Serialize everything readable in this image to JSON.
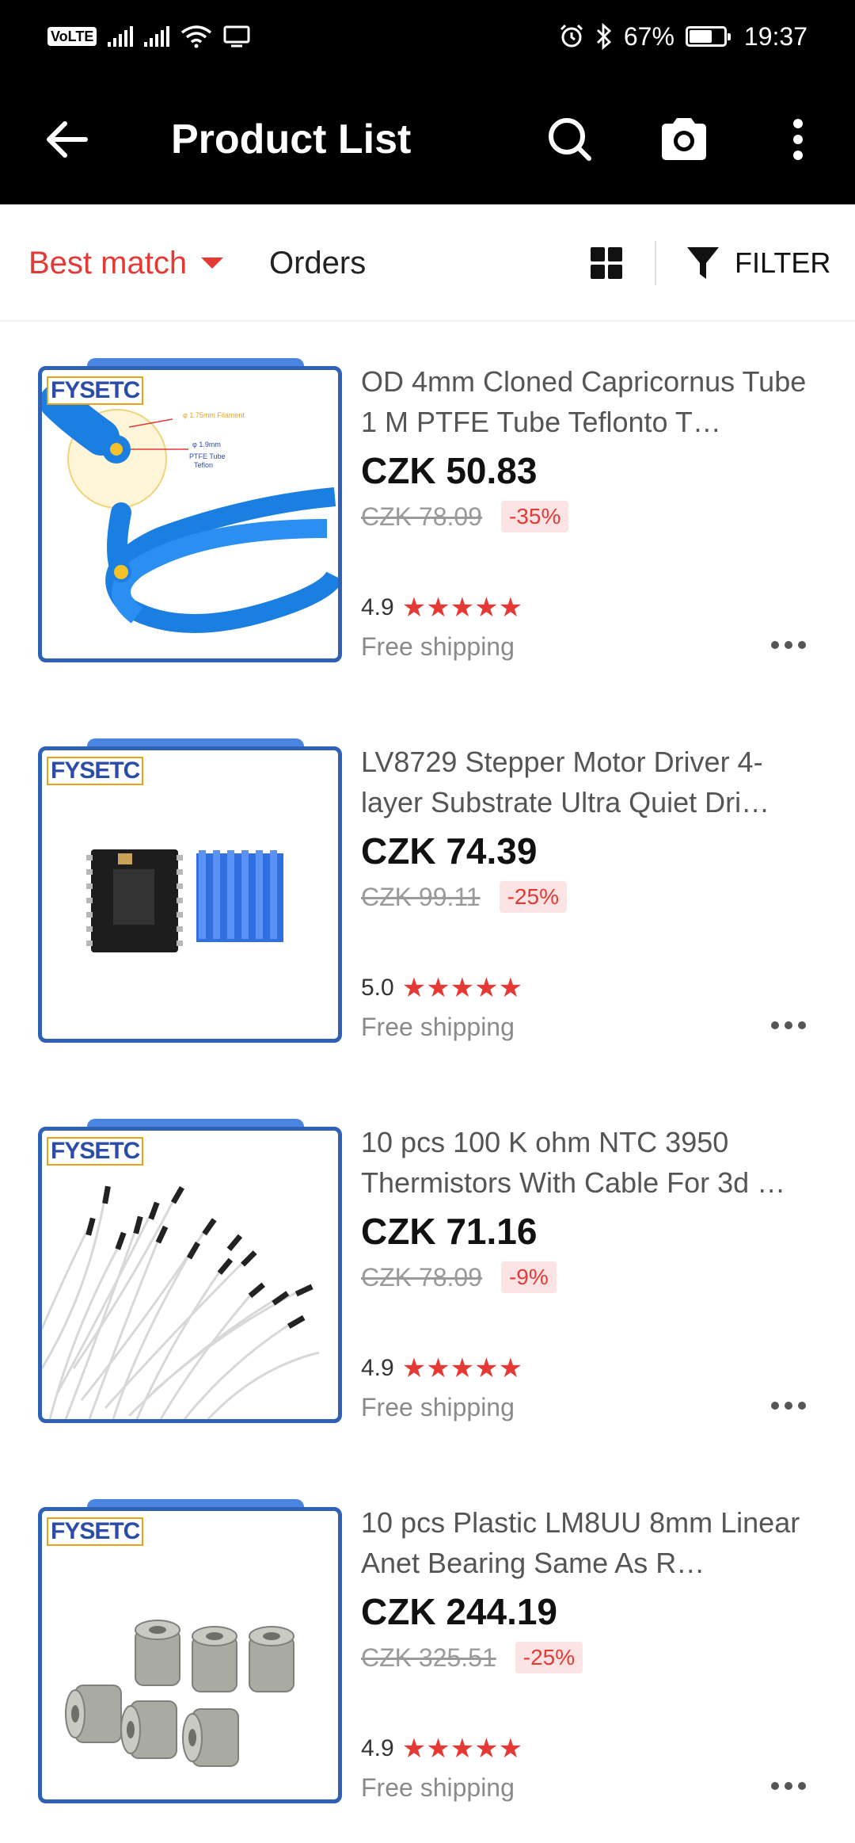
{
  "status_bar": {
    "volte": "VoLTE",
    "battery_text": "67%",
    "battery_level": 0.67,
    "time": "19:37",
    "icons": [
      "signal-icon",
      "signal-icon",
      "wifi-icon",
      "screen-cast-icon",
      "alarm-icon",
      "bluetooth-icon",
      "battery-icon"
    ]
  },
  "app_bar": {
    "title": "Product List",
    "icons": [
      "back-arrow-icon",
      "search-icon",
      "camera-icon",
      "more-vert-icon"
    ]
  },
  "sort_bar": {
    "best_match": "Best match",
    "orders": "Orders",
    "filter": "FILTER",
    "accent_color": "#e53935"
  },
  "products": [
    {
      "title": "OD 4mm Cloned Capricornus Tube 1 M PTFE Tube Teflonto T…",
      "price": "CZK 50.83",
      "original_price": "CZK 78.09",
      "discount": "-35%",
      "rating": "4.9",
      "stars": "★★★★★",
      "shipping": "Free shipping",
      "brand": "FYSETC",
      "image_labels": [
        "φ 1.75mm Filament",
        "φ 1.9mm",
        "PTFE Tube",
        "Teflon"
      ]
    },
    {
      "title": "LV8729 Stepper Motor Driver 4-layer Substrate Ultra Quiet Dri…",
      "price": "CZK 74.39",
      "original_price": "CZK 99.11",
      "discount": "-25%",
      "rating": "5.0",
      "stars": "★★★★★",
      "shipping": "Free shipping",
      "brand": "FYSETC"
    },
    {
      "title": "10 pcs 100 K ohm NTC 3950 Thermistors With Cable For 3d …",
      "price": "CZK 71.16",
      "original_price": "CZK 78.09",
      "discount": "-9%",
      "rating": "4.9",
      "stars": "★★★★★",
      "shipping": "Free shipping",
      "brand": "FYSETC"
    },
    {
      "title": "10 pcs Plastic LM8UU 8mm Linear Anet Bearing Same As R…",
      "price": "CZK 244.19",
      "original_price": "CZK 325.51",
      "discount": "-25%",
      "rating": "4.9",
      "stars": "★★★★★",
      "shipping": "Free shipping",
      "brand": "FYSETC"
    }
  ]
}
